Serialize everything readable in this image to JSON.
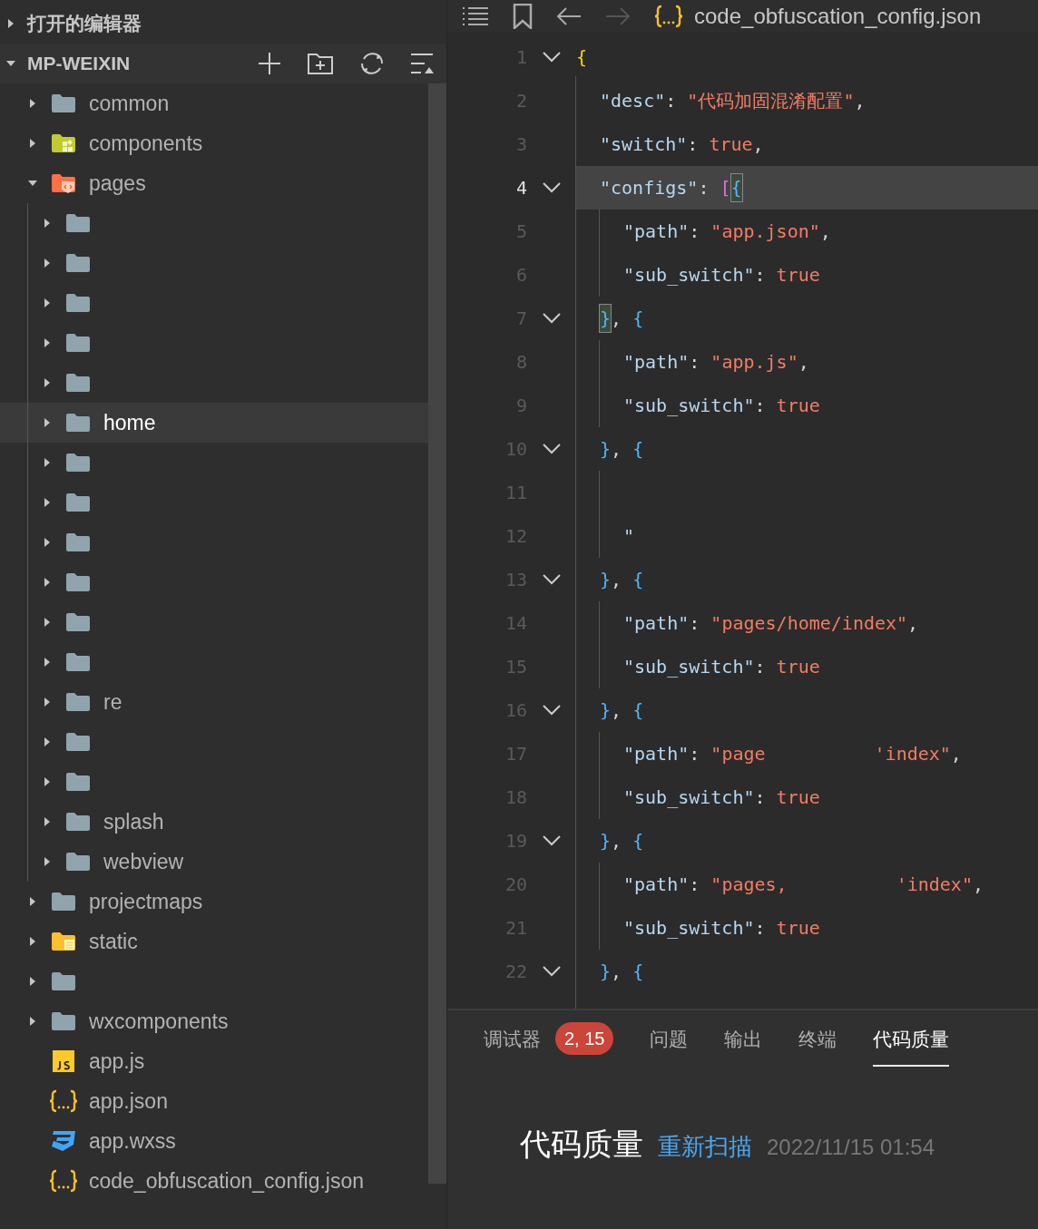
{
  "sidebar": {
    "sections": [
      {
        "title": "打开的编辑器",
        "expanded": false
      },
      {
        "title": "MP-WEIXIN",
        "expanded": true
      }
    ],
    "tree": [
      {
        "label": "common",
        "kind": "folder",
        "expanded": false,
        "selected": false
      },
      {
        "label": "components",
        "kind": "components-folder",
        "expanded": false,
        "selected": false
      },
      {
        "label": "pages",
        "kind": "pages-folder",
        "expanded": true,
        "selected": false,
        "children": [
          {
            "kind": "folder",
            "expanded": false,
            "selected": false
          },
          {
            "kind": "folder",
            "expanded": false,
            "selected": false
          },
          {
            "kind": "folder",
            "expanded": false,
            "selected": false
          },
          {
            "kind": "folder",
            "expanded": false,
            "selected": false
          },
          {
            "kind": "folder",
            "expanded": false,
            "selected": false
          },
          {
            "label": "home",
            "kind": "folder",
            "expanded": false,
            "selected": true
          },
          {
            "kind": "folder",
            "expanded": false,
            "selected": false
          },
          {
            "kind": "folder",
            "expanded": false,
            "selected": false
          },
          {
            "kind": "folder",
            "expanded": false,
            "selected": false
          },
          {
            "kind": "folder",
            "expanded": false,
            "selected": false
          },
          {
            "kind": "folder",
            "expanded": false,
            "selected": false
          },
          {
            "kind": "folder",
            "expanded": false,
            "selected": false
          },
          {
            "label": "re",
            "kind": "folder",
            "expanded": false,
            "selected": false
          },
          {
            "kind": "folder",
            "expanded": false,
            "selected": false
          },
          {
            "kind": "folder",
            "expanded": false,
            "selected": false
          },
          {
            "label": "splash",
            "kind": "folder",
            "expanded": false,
            "selected": false
          },
          {
            "label": "webview",
            "kind": "folder",
            "expanded": false,
            "selected": false
          }
        ]
      },
      {
        "label": "projectmaps",
        "kind": "folder",
        "expanded": false,
        "selected": false
      },
      {
        "label": "static",
        "kind": "static-folder",
        "expanded": false,
        "selected": false
      },
      {
        "kind": "folder",
        "expanded": false,
        "selected": false
      },
      {
        "label": "wxcomponents",
        "kind": "folder",
        "expanded": false,
        "selected": false
      },
      {
        "label": "app.js",
        "kind": "js-file",
        "selected": false
      },
      {
        "label": "app.json",
        "kind": "json-file",
        "selected": false
      },
      {
        "label": "app.wxss",
        "kind": "wxss-file",
        "selected": false
      },
      {
        "label": "code_obfuscation_config.json",
        "kind": "json-file",
        "selected": false
      }
    ]
  },
  "editor": {
    "file": "code_obfuscation_config.json",
    "lines": [
      {
        "num": "1",
        "fold": true,
        "selected": false,
        "kind": "root",
        "tokens": [
          {
            "kind": "brace-gold",
            "text": "{"
          }
        ]
      },
      {
        "num": "2",
        "fold": false,
        "selected": false,
        "kind": "member",
        "tokens": [
          {
            "kind": "key",
            "text": "\"desc\""
          },
          {
            "kind": "punct",
            "text": ": "
          },
          {
            "kind": "string",
            "text": "\"代码加固混淆配置\""
          },
          {
            "kind": "punct",
            "text": ","
          }
        ]
      },
      {
        "num": "3",
        "fold": false,
        "selected": false,
        "kind": "member",
        "tokens": [
          {
            "kind": "key",
            "text": "\"switch\""
          },
          {
            "kind": "punct",
            "text": ": "
          },
          {
            "kind": "literal",
            "text": "true"
          },
          {
            "kind": "punct",
            "text": ","
          }
        ]
      },
      {
        "num": "4",
        "fold": true,
        "selected": true,
        "kind": "member",
        "tokens": [
          {
            "kind": "key",
            "text": "\"configs\""
          },
          {
            "kind": "punct",
            "text": ": "
          },
          {
            "kind": "brace-pink",
            "text": "["
          },
          {
            "kind": "brace-blue",
            "text": "{",
            "matched": true
          }
        ]
      },
      {
        "num": "5",
        "fold": false,
        "selected": false,
        "kind": "inner",
        "tokens": [
          {
            "kind": "key",
            "text": "\"path\""
          },
          {
            "kind": "punct",
            "text": ": "
          },
          {
            "kind": "string",
            "text": "\"app.json\""
          },
          {
            "kind": "punct",
            "text": ","
          }
        ]
      },
      {
        "num": "6",
        "fold": false,
        "selected": false,
        "kind": "inner",
        "tokens": [
          {
            "kind": "key",
            "text": "\"sub_switch\""
          },
          {
            "kind": "punct",
            "text": ": "
          },
          {
            "kind": "literal",
            "text": "true"
          }
        ]
      },
      {
        "num": "7",
        "fold": true,
        "selected": false,
        "kind": "member",
        "tokens": [
          {
            "kind": "brace-blue",
            "text": "}",
            "matched": true
          },
          {
            "kind": "punct",
            "text": ", "
          },
          {
            "kind": "brace-blue",
            "text": "{"
          }
        ]
      },
      {
        "num": "8",
        "fold": false,
        "selected": false,
        "kind": "inner",
        "tokens": [
          {
            "kind": "key",
            "text": "\"path\""
          },
          {
            "kind": "punct",
            "text": ": "
          },
          {
            "kind": "string",
            "text": "\"app.js\""
          },
          {
            "kind": "punct",
            "text": ","
          }
        ]
      },
      {
        "num": "9",
        "fold": false,
        "selected": false,
        "kind": "inner",
        "tokens": [
          {
            "kind": "key",
            "text": "\"sub_switch\""
          },
          {
            "kind": "punct",
            "text": ": "
          },
          {
            "kind": "literal",
            "text": "true"
          }
        ]
      },
      {
        "num": "10",
        "fold": true,
        "selected": false,
        "kind": "member",
        "tokens": [
          {
            "kind": "brace-blue",
            "text": "}"
          },
          {
            "kind": "punct",
            "text": ", "
          },
          {
            "kind": "brace-blue",
            "text": "{"
          }
        ]
      },
      {
        "num": "11",
        "fold": false,
        "selected": false,
        "kind": "inner"
      },
      {
        "num": "12",
        "fold": false,
        "selected": false,
        "kind": "inner",
        "tokens": [
          {
            "kind": "key",
            "text": "\""
          }
        ]
      },
      {
        "num": "13",
        "fold": true,
        "selected": false,
        "kind": "member",
        "tokens": [
          {
            "kind": "brace-blue",
            "text": "}"
          },
          {
            "kind": "punct",
            "text": ", "
          },
          {
            "kind": "brace-blue",
            "text": "{"
          }
        ]
      },
      {
        "num": "14",
        "fold": false,
        "selected": false,
        "kind": "inner",
        "tokens": [
          {
            "kind": "key",
            "text": "\"path\""
          },
          {
            "kind": "punct",
            "text": ": "
          },
          {
            "kind": "string",
            "text": "\"pages/home/index\""
          },
          {
            "kind": "punct",
            "text": ","
          }
        ]
      },
      {
        "num": "15",
        "fold": false,
        "selected": false,
        "kind": "inner",
        "tokens": [
          {
            "kind": "key",
            "text": "\"sub_switch\""
          },
          {
            "kind": "punct",
            "text": ": "
          },
          {
            "kind": "literal",
            "text": "true"
          }
        ]
      },
      {
        "num": "16",
        "fold": true,
        "selected": false,
        "kind": "member",
        "tokens": [
          {
            "kind": "brace-blue",
            "text": "}"
          },
          {
            "kind": "punct",
            "text": ", "
          },
          {
            "kind": "brace-blue",
            "text": "{"
          }
        ]
      },
      {
        "num": "17",
        "fold": false,
        "selected": false,
        "kind": "inner",
        "tokens": [
          {
            "kind": "key",
            "text": "\"path\""
          },
          {
            "kind": "punct",
            "text": ": "
          },
          {
            "kind": "string",
            "text": "\"page"
          },
          {
            "kind": "gap"
          },
          {
            "kind": "string",
            "text": "'index\""
          },
          {
            "kind": "punct",
            "text": ","
          }
        ]
      },
      {
        "num": "18",
        "fold": false,
        "selected": false,
        "kind": "inner",
        "tokens": [
          {
            "kind": "key",
            "text": "\"sub_switch\""
          },
          {
            "kind": "punct",
            "text": ": "
          },
          {
            "kind": "literal",
            "text": "true"
          }
        ]
      },
      {
        "num": "19",
        "fold": true,
        "selected": false,
        "kind": "member",
        "tokens": [
          {
            "kind": "brace-blue",
            "text": "}"
          },
          {
            "kind": "punct",
            "text": ", "
          },
          {
            "kind": "brace-blue",
            "text": "{"
          }
        ]
      },
      {
        "num": "20",
        "fold": false,
        "selected": false,
        "kind": "inner",
        "tokens": [
          {
            "kind": "key",
            "text": "\"path\""
          },
          {
            "kind": "punct",
            "text": ": "
          },
          {
            "kind": "string",
            "text": "\"pages,"
          },
          {
            "kind": "gap"
          },
          {
            "kind": "string",
            "text": "'index\""
          },
          {
            "kind": "punct",
            "text": ","
          }
        ]
      },
      {
        "num": "21",
        "fold": false,
        "selected": false,
        "kind": "inner",
        "tokens": [
          {
            "kind": "key",
            "text": "\"sub_switch\""
          },
          {
            "kind": "punct",
            "text": ": "
          },
          {
            "kind": "literal",
            "text": "true"
          }
        ]
      },
      {
        "num": "22",
        "fold": true,
        "selected": false,
        "kind": "member",
        "tokens": [
          {
            "kind": "brace-blue",
            "text": "}"
          },
          {
            "kind": "punct",
            "text": ", "
          },
          {
            "kind": "brace-blue",
            "text": "{"
          }
        ]
      }
    ]
  },
  "panel": {
    "tabs": [
      {
        "label": "调试器",
        "badge": "2, 15",
        "selected": false
      },
      {
        "label": "问题",
        "selected": false
      },
      {
        "label": "输出",
        "selected": false
      },
      {
        "label": "终端",
        "selected": false
      },
      {
        "label": "代码质量",
        "selected": true
      }
    ],
    "title": "代码质量",
    "action": "重新扫描",
    "timestamp": "2022/11/15 01:54"
  }
}
